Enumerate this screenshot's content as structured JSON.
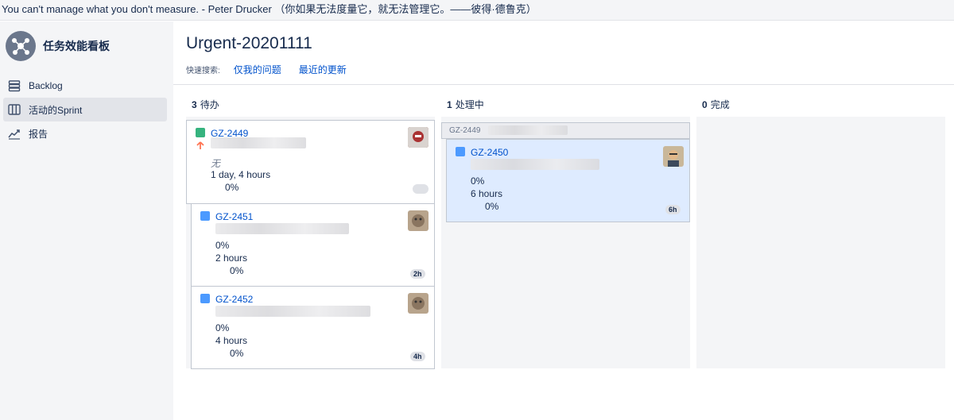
{
  "quote": "You can't manage what you don't measure. - Peter Drucker （你如果无法度量它，就无法管理它。——彼得·德鲁克）",
  "sidebar": {
    "project_name": "任务效能看板",
    "items": [
      {
        "label": "Backlog",
        "icon": "backlog-icon"
      },
      {
        "label": "活动的Sprint",
        "icon": "board-icon",
        "active": true
      },
      {
        "label": "报告",
        "icon": "report-icon"
      }
    ]
  },
  "board": {
    "title": "Urgent-20201111",
    "quick_search_label": "快速搜索:",
    "quick_filters": [
      "仅我的问题",
      "最近的更新"
    ]
  },
  "columns": [
    {
      "count": "3",
      "name": "待办"
    },
    {
      "count": "1",
      "name": "处理中"
    },
    {
      "count": "0",
      "name": "完成"
    }
  ],
  "todo": {
    "parent": {
      "key": "GZ-2449",
      "none_label": "无",
      "estimate": "1 day, 4 hours",
      "progress": "0%"
    },
    "subtasks": [
      {
        "key": "GZ-2451",
        "percent": "0%",
        "estimate": "2 hours",
        "progress": "0%",
        "badge": "2h"
      },
      {
        "key": "GZ-2452",
        "percent": "0%",
        "estimate": "4 hours",
        "progress": "0%",
        "badge": "4h"
      }
    ]
  },
  "in_progress": {
    "swimlane_key": "GZ-2449",
    "card": {
      "key": "GZ-2450",
      "percent": "0%",
      "estimate": "6 hours",
      "progress": "0%",
      "badge": "6h"
    }
  },
  "colors": {
    "accent": "#0052cc",
    "selected_card": "#deebff",
    "column_bg": "#f4f5f7"
  }
}
